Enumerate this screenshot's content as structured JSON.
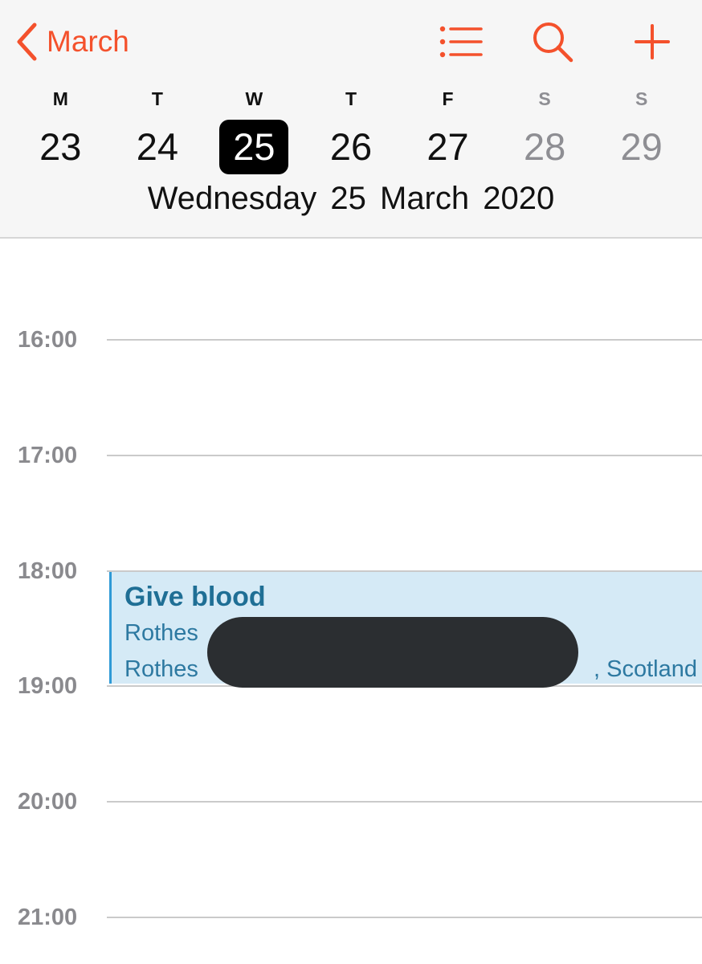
{
  "header": {
    "back_label": "March",
    "icons": {
      "back": "chevron-left-icon",
      "list": "list-icon",
      "search": "search-icon",
      "add": "plus-icon"
    },
    "accent_color": "#f4512c"
  },
  "week": {
    "days": [
      {
        "letter": "M",
        "number": "23",
        "weekend": false,
        "selected": false
      },
      {
        "letter": "T",
        "number": "24",
        "weekend": false,
        "selected": false
      },
      {
        "letter": "W",
        "number": "25",
        "weekend": false,
        "selected": true
      },
      {
        "letter": "T",
        "number": "26",
        "weekend": false,
        "selected": false
      },
      {
        "letter": "F",
        "number": "27",
        "weekend": false,
        "selected": false
      },
      {
        "letter": "S",
        "number": "28",
        "weekend": true,
        "selected": false
      },
      {
        "letter": "S",
        "number": "29",
        "weekend": true,
        "selected": false
      }
    ],
    "selected_caption": "Wednesday  25 March 2020"
  },
  "timeline": {
    "hours": [
      "16:00",
      "17:00",
      "18:00",
      "19:00",
      "20:00",
      "21:00"
    ],
    "event": {
      "title": "Give blood",
      "location_line1": "Rothes",
      "location_line2": "Rothes",
      "location_line2_end": ", Scotland",
      "color": "#d5eaf6",
      "start": "18:00",
      "end": "19:00"
    }
  }
}
